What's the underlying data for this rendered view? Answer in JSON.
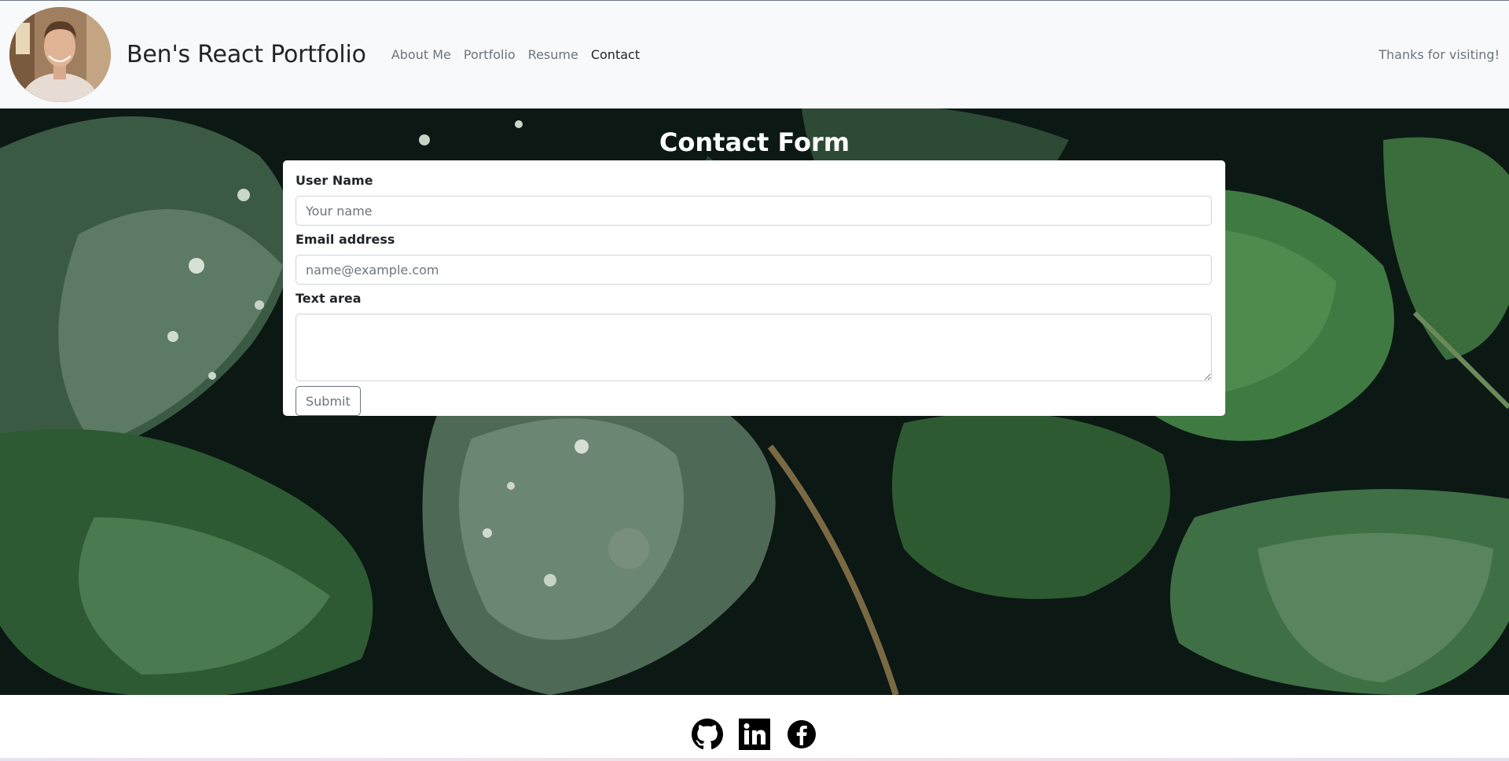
{
  "navbar": {
    "brand": "Ben's React Portfolio",
    "links": [
      {
        "label": "About Me",
        "active": false
      },
      {
        "label": "Portfolio",
        "active": false
      },
      {
        "label": "Resume",
        "active": false
      },
      {
        "label": "Contact",
        "active": true
      }
    ],
    "right_text": "Thanks for visiting!",
    "avatar_icon": "profile-photo"
  },
  "main": {
    "title": "Contact Form",
    "form": {
      "username_label": "User Name",
      "username_placeholder": "Your name",
      "username_value": "",
      "email_label": "Email address",
      "email_placeholder": "name@example.com",
      "email_value": "",
      "textarea_label": "Text area",
      "textarea_value": "",
      "submit_label": "Submit"
    }
  },
  "footer": {
    "icons": [
      "github-icon",
      "linkedin-icon",
      "facebook-icon"
    ]
  },
  "colors": {
    "navbar_bg": "#f8f9fa",
    "link_muted": "#6c757d",
    "link_active": "#212529",
    "hero_leaf": "#3f6b42"
  }
}
